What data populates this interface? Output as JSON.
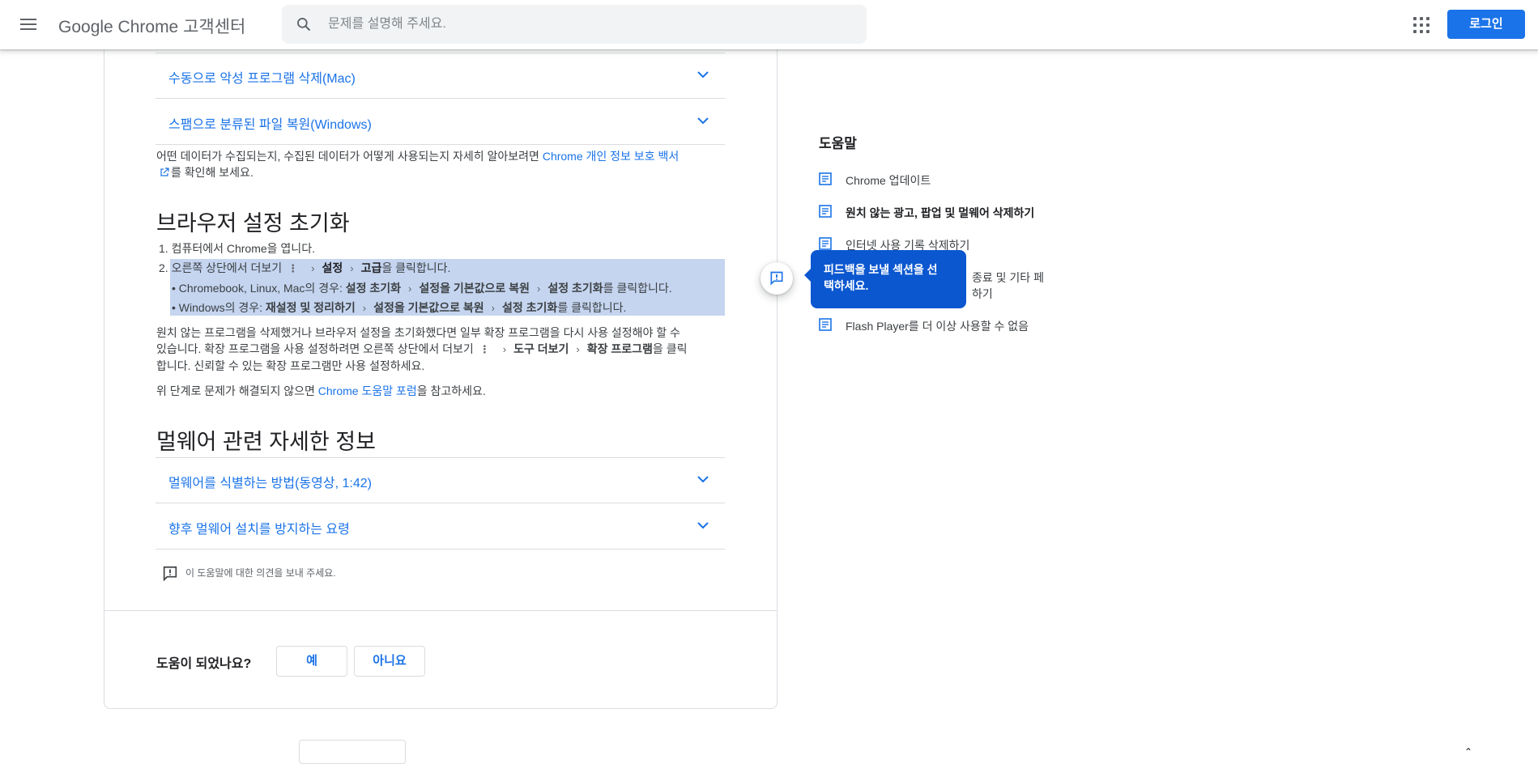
{
  "header": {
    "brand": "Google Chrome 고객센터",
    "search_placeholder": "문제를 설명해 주세요.",
    "login_label": "로그인"
  },
  "article": {
    "accordion_top": [
      {
        "label": "수동으로 악성 프로그램 삭제(Mac)"
      },
      {
        "label": "스팸으로 분류된 파일 복원(Windows)"
      }
    ],
    "privacy_text_1": "어떤 데이터가 수집되는지, 수집된 데이터가 어떻게 사용되는지 자세히 알아보려면 ",
    "privacy_link": "Chrome 개인 정보 보호 백서",
    "privacy_text_2": "를 확인해 보세요.",
    "reset_heading": "브라우저 설정 초기화",
    "step1": {
      "num": "1.",
      "text": "컴퓨터에서 Chrome을 엽니다."
    },
    "step2": {
      "num": "2.",
      "prefix": "오른쪽 상단에서 더보기",
      "settings": "설정",
      "advanced": "고급",
      "suffix": "을 클릭합니다."
    },
    "sub1": {
      "bullet": "•",
      "prefix": "Chromebook, Linux, Mac의 경우: ",
      "a": "설정 초기화",
      "b": "설정을 기본값으로 복원",
      "c": "설정 초기화",
      "suffix": "를 클릭합니다."
    },
    "sub2": {
      "bullet": "•",
      "prefix": "Windows의 경우: ",
      "a": "재설정 및 정리하기",
      "b": "설정을 기본값으로 복원",
      "c": "설정 초기화",
      "suffix": "를 클릭합니다."
    },
    "ext_line1": "원치 않는 프로그램을 삭제했거나 브라우저 설정을 초기화했다면 일부 확장 프로그램을 다시 사용 설정해야 할 수",
    "ext_line2_prefix": "있습니다. 확장 프로그램을 사용 설정하려면 오른쪽 상단에서 더보기",
    "ext_tools": "도구 더보기",
    "ext_extensions": "확장 프로그램",
    "ext_line2_suffix": "을 클릭",
    "ext_line3": "합니다. 신뢰할 수 있는 확장 프로그램만 사용 설정하세요.",
    "forum_prefix": "위 단계로 문제가 해결되지 않으면 ",
    "forum_link": "Chrome 도움말 포럼",
    "forum_suffix": "을 참고하세요.",
    "malware_heading": "멀웨어 관련 자세한 정보",
    "accordion_bottom": [
      {
        "label": "멀웨어를 식별하는 방법(동영상, 1:42)"
      },
      {
        "label": "향후 멀웨어 설치를 방지하는 요령"
      }
    ],
    "feedback_text": "이 도움말에 대한 의견을 보내 주세요.",
    "helpful_question": "도움이 되었나요?",
    "yes_label": "예",
    "no_label": "아니요"
  },
  "sidebar": {
    "title": "도움말",
    "items": [
      {
        "label": "Chrome 업데이트",
        "active": false
      },
      {
        "label": "원치 않는 광고, 팝업 및 멀웨어 삭제하기",
        "active": true
      },
      {
        "label": "인터넷 사용 기록 삭제하기",
        "active": false
      },
      {
        "label": "종료 및 기타 페",
        "active": false
      },
      {
        "label": "하기",
        "active": false
      },
      {
        "label": "Flash Player를 더 이상 사용할 수 없음",
        "active": false
      }
    ]
  },
  "feedback_tooltip": {
    "line1": "피드백을 보낼 섹션을 선",
    "line2": "택하세요."
  },
  "colors": {
    "accent": "#1a73e8",
    "tooltip": "#0b57d0",
    "highlight": "#c5d5f0"
  }
}
